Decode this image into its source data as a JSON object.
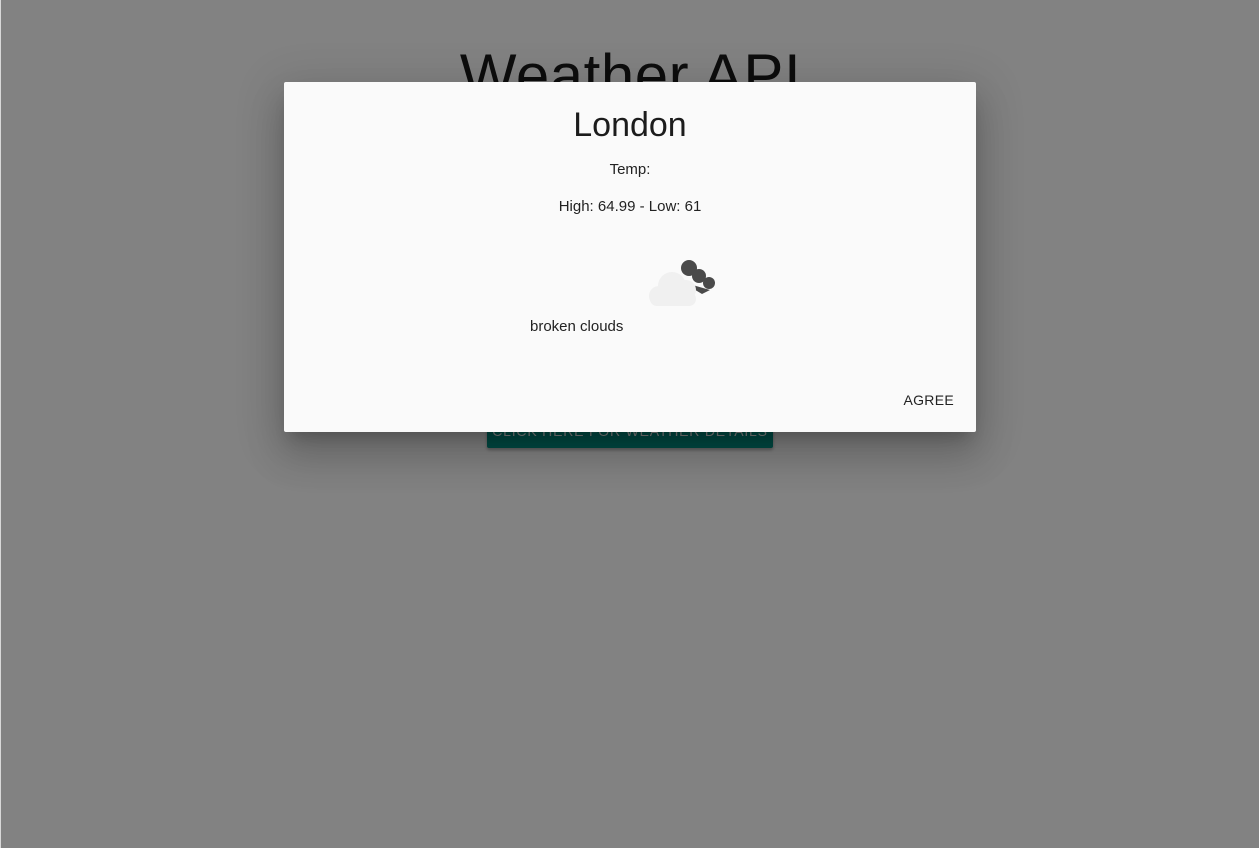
{
  "page": {
    "title": "Weather API",
    "details_button_label": "CLICK HERE FOR WEATHER DETAILS"
  },
  "dialog": {
    "city": "London",
    "temp_label": "Temp:",
    "temp_range": "High: 64.99 - Low: 61",
    "weather_icon": "broken-clouds-icon",
    "description": "broken clouds",
    "agree_label": "AGREE"
  },
  "colors": {
    "accent": "#009688",
    "backdrop": "rgba(0,0,0,0.49)",
    "dialog_bg": "#fafafa"
  }
}
